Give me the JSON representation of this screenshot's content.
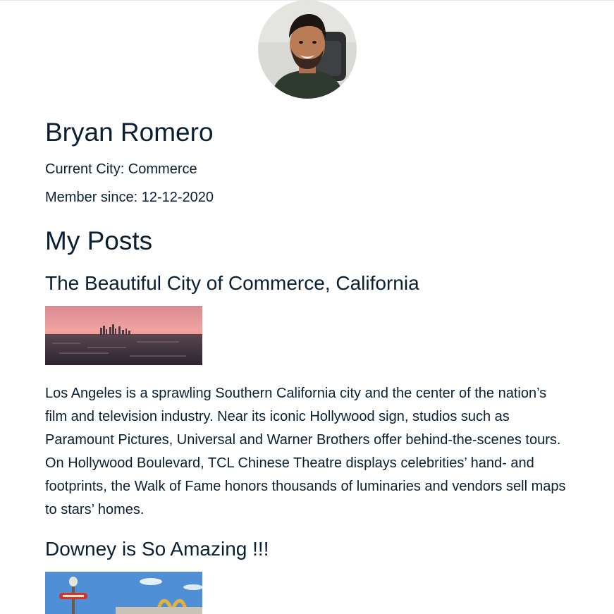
{
  "profile": {
    "avatar_icon": "user-avatar-photo",
    "name": "Bryan Romero",
    "current_city": "Current City: Commerce",
    "member_since": "Member since: 12-12-2020"
  },
  "posts_section": {
    "title": "My Posts"
  },
  "posts": [
    {
      "title": "The Beautiful City of Commerce, California",
      "image_icon": "city-skyline-photo",
      "body": "Los Angeles is a sprawling Southern California city and the center of the nation’s film and television industry. Near its iconic Hollywood sign, studios such as Paramount Pictures, Universal and Warner Brothers offer behind-the-scenes tours. On Hollywood Boulevard, TCL Chinese Theatre displays celebrities’ hand- and footprints, the Walk of Fame honors thousands of luminaries and vendors sell maps to stars’ homes."
    },
    {
      "title": "Downey is So Amazing !!!",
      "image_icon": "restaurant-sign-photo"
    }
  ],
  "colors": {
    "text": "#0b1f33",
    "background": "#ffffff"
  }
}
